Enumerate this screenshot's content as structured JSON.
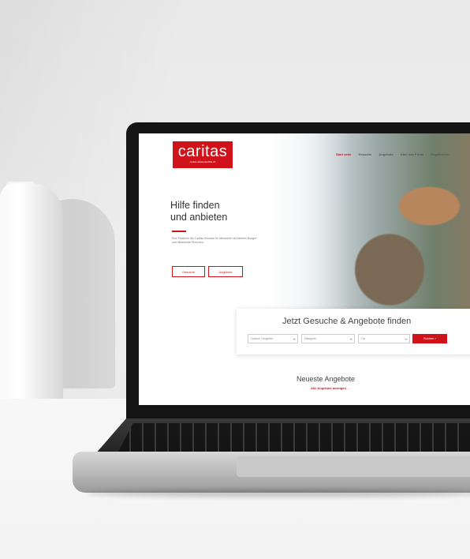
{
  "website": {
    "logo": {
      "word": "caritas",
      "subtitle": "caritas.wirkendeshilfe.ch"
    },
    "nav": [
      {
        "label": "Start seite",
        "active": true
      },
      {
        "label": "Gesuche",
        "active": false
      },
      {
        "label": "Angebote",
        "active": false
      },
      {
        "label": "Über das Portal",
        "active": false
      },
      {
        "label": "Registrieren",
        "active": false
      }
    ],
    "hero": {
      "title_line1": "Hilfe finden",
      "title_line2": "und anbieten",
      "text": "Eine Plattform der Caritas Schweiz für Menschen mit kleinem Budget und hilfsbereite Personen.",
      "button_gesuche": "Gesuche",
      "button_angebote": "Angebote"
    },
    "search": {
      "title": "Jetzt Gesuche & Angebote finden",
      "select_category": "Gesuch / Angebot",
      "select_subcategory": "Kategorie",
      "select_location": "Ort",
      "button": "Suchen"
    },
    "newest": {
      "title": "Neueste Angebote",
      "link": "Alle Angebote anzeigen"
    }
  },
  "colors": {
    "brand_red": "#d0121b",
    "laptop_bezel": "#151515"
  }
}
